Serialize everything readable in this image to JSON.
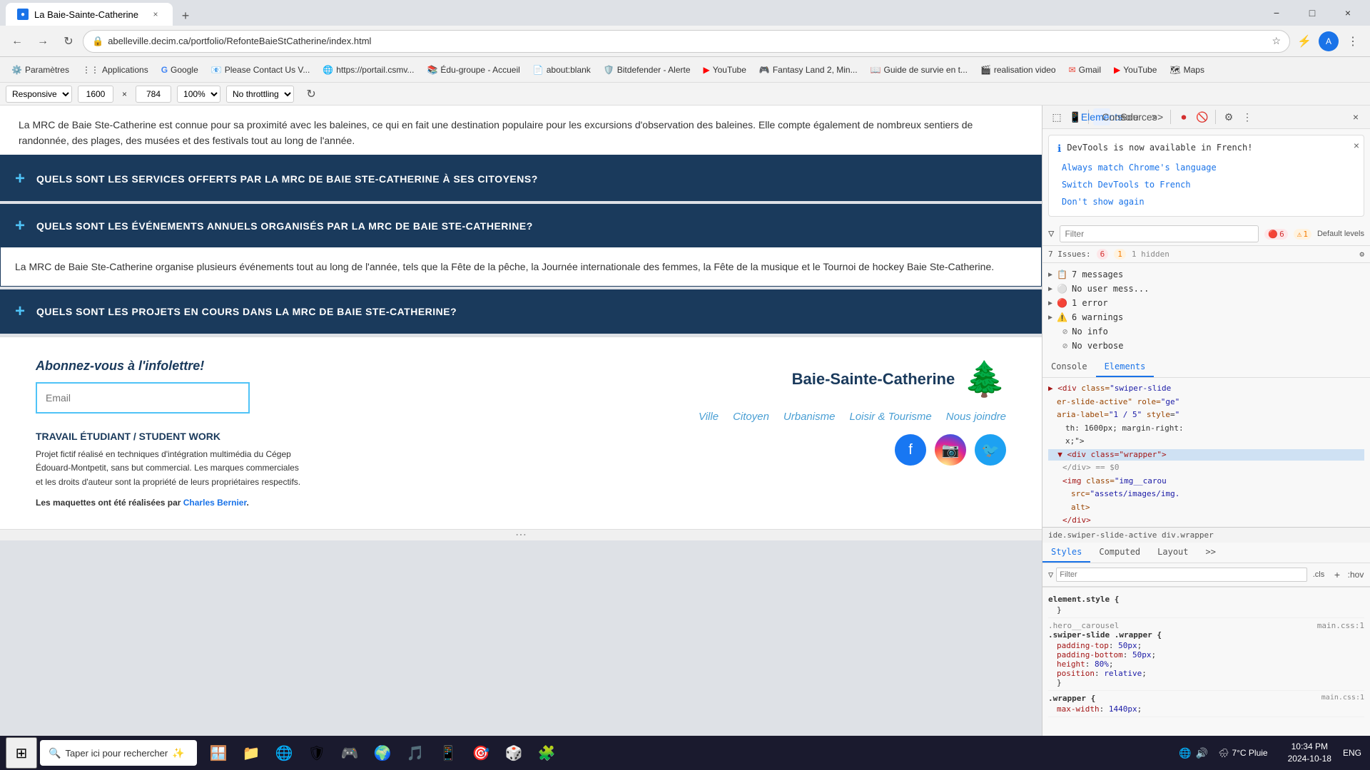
{
  "browser": {
    "tab_title": "La Baie-Sainte-Catherine",
    "url": "abelleville.decim.ca/portfolio/RefonteBaieStCatherine/index.html",
    "window_controls": {
      "minimize": "−",
      "maximize": "□",
      "close": "×"
    }
  },
  "bookmarks": [
    {
      "label": "Paramètres",
      "icon": "⚙️"
    },
    {
      "label": "Applications",
      "icon": "📦"
    },
    {
      "label": "Google",
      "icon": "G"
    },
    {
      "label": "Please Contact Us V...",
      "icon": "📧"
    },
    {
      "label": "https://portail.csmv...",
      "icon": "🌐"
    },
    {
      "label": "Édu-groupe - Accueil",
      "icon": "📚"
    },
    {
      "label": "about:blank",
      "icon": "📄"
    },
    {
      "label": "Bitdefender - Alerte",
      "icon": "🛡️"
    },
    {
      "label": "YouTube",
      "icon": "▶"
    },
    {
      "label": "Fantasy Land 2, Min...",
      "icon": "🎮"
    },
    {
      "label": "Guide de survie en t...",
      "icon": "📖"
    },
    {
      "label": "realisation video",
      "icon": "🎬"
    },
    {
      "label": "Gmail",
      "icon": "✉"
    },
    {
      "label": "YouTube",
      "icon": "▶"
    },
    {
      "label": "Maps",
      "icon": "🗺"
    }
  ],
  "dimensions_bar": {
    "mode": "Responsive",
    "width": "1600",
    "height": "784",
    "zoom": "100%",
    "throttle": "No throttling"
  },
  "webpage": {
    "faq_intro": "La MRC de Baie Ste-Catherine est connue pour sa proximité avec les baleines, ce qui en fait une destination populaire pour les excursions d'observation des baleines. Elle compte également de nombreux sentiers de randonnée, des plages, des musées et des festivals tout au long de l'année.",
    "faq_items": [
      {
        "question": "QUELS SONT LES SERVICES OFFERTS PAR LA MRC DE BAIE STE-CATHERINE À SES CITOYENS?",
        "answer": "",
        "open": false
      },
      {
        "question": "QUELS SONT LES ÉVÉNEMENTS ANNUELS ORGANISÉS PAR LA MRC DE BAIE STE-CATHERINE?",
        "answer": "La MRC de Baie Ste-Catherine organise plusieurs événements tout au long de l'année, tels que la Fête de la pêche, la Journée internationale des femmes, la Fête de la musique et le Tournoi de hockey Baie Ste-Catherine.",
        "open": true
      },
      {
        "question": "QUELS SONT LES PROJETS EN COURS DANS LA MRC DE BAIE STE-CATHERINE?",
        "answer": "",
        "open": false
      }
    ],
    "subscribe_title": "Abonnez-vous à l'infolettre!",
    "email_placeholder": "Email",
    "logo_text": "Baie-Sainte-Catherine",
    "footer_nav": [
      "Ville",
      "Citoyen",
      "Urbanisme",
      "Loisir & Tourisme",
      "Nous joindre"
    ],
    "work_title": "TRAVAIL ÉTUDIANT / STUDENT WORK",
    "work_text": "Projet fictif réalisé en techniques d'intégration multimédia du Cégep Édouard-Montpetit, sans but commercial. Les marques commerciales et les droits d'auteur sont la propriété de leurs propriétaires respectifs.",
    "maquettes_text": "Les maquettes ont été réalisées par",
    "author_name": "Charles Bernier",
    "author_link": "#"
  },
  "devtools": {
    "notification": {
      "title": "DevTools is now available in French!",
      "link1": "Always match Chrome's language",
      "link2": "Switch DevTools to French",
      "link3": "Don't show again"
    },
    "filter_placeholder": "Filter",
    "default_levels": "Default levels",
    "issues": {
      "count_label": "7 Issues:",
      "error_count": "6",
      "warn_count": "1",
      "hidden": "1 hidden"
    },
    "messages": [
      {
        "icon": "▶",
        "type": "expand",
        "text": "7 messages",
        "count": ""
      },
      {
        "icon": "▶",
        "type": "expand",
        "text": "No user mess...",
        "count": ""
      },
      {
        "icon": "▶",
        "type": "error",
        "text": "1 error",
        "count": ""
      },
      {
        "icon": "▶",
        "type": "warning",
        "text": "6 warnings",
        "count": ""
      },
      {
        "icon": "",
        "type": "info",
        "text": "No info",
        "count": ""
      },
      {
        "icon": "",
        "type": "verbose",
        "text": "No verbose",
        "count": ""
      }
    ],
    "console_tab": "Console",
    "elements_tab": "Elements",
    "code_lines": [
      "▶ <div class=\"swiper-slider-active\" role=\"ge\"",
      "aria-label=\"1 / 5\" style=\"",
      "th: 1600px; margin-right:",
      "x;\">",
      "▼ <div class=\"wrapper\">",
      "    </div> == $0",
      "    <img class=\"img__carou",
      "src=\"assets/images/img.",
      "alt>",
      "    </div>",
      "    ..."
    ],
    "selector_bar": "ide.swiper-slide-active  div.wrapper",
    "styles_tab": "Styles",
    "computed_tab": "Computed",
    "layout_tab": "Layout",
    "style_filter": "",
    "style_rules": [
      {
        "selector": "element.style {",
        "source": "",
        "props": [
          "}",
          ".hero__carousel  main.css:1",
          ".swiper-slide .wrapper {",
          "    padding-top: 50px;",
          "    padding-bottom: 50px;",
          "    height: 80%;",
          "    position: relative;",
          "}",
          ".wrapper {  main.css:1",
          "    max-width: 1440px;"
        ]
      }
    ]
  },
  "taskbar": {
    "search_placeholder": "Taper ici pour rechercher",
    "time": "10:34 PM",
    "date": "2024-10-18",
    "language": "ENG",
    "weather": "7°C Pluie",
    "icons": [
      "⊞",
      "🔍",
      "🪟",
      "📁",
      "🌐",
      "🛡",
      "🎮",
      "🌍",
      "🎵",
      "📱",
      "🎯",
      "🎲"
    ]
  }
}
